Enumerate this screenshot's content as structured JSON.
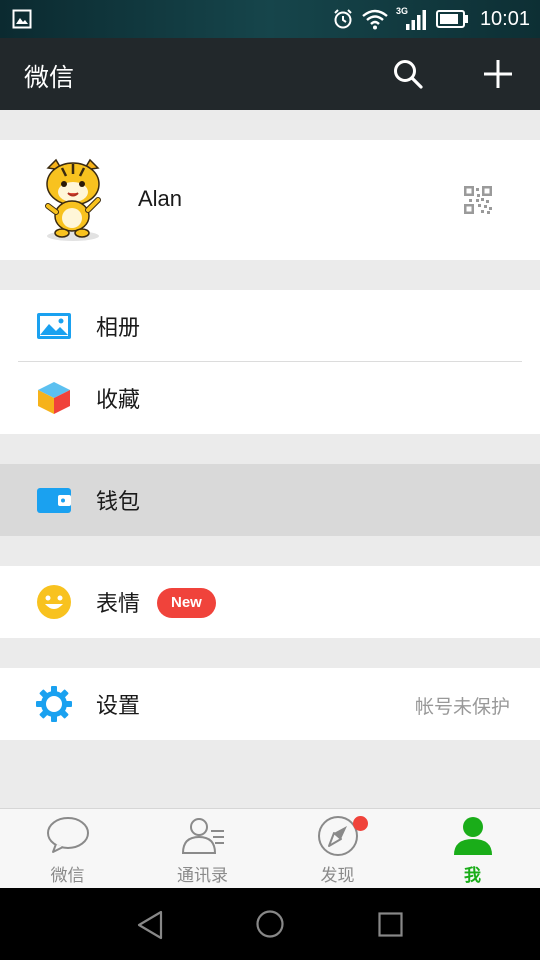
{
  "status_bar": {
    "time": "10:01",
    "network": "3G",
    "icons": [
      "image-notification-icon",
      "alarm-icon",
      "wifi-icon",
      "signal-icon",
      "battery-icon"
    ]
  },
  "header": {
    "title": "微信",
    "icons": [
      "search-icon",
      "add-icon"
    ]
  },
  "profile": {
    "name": "Alan",
    "icons": [
      "avatar",
      "qr-code-icon"
    ]
  },
  "menu": {
    "album": {
      "label": "相册",
      "icon": "album-icon"
    },
    "favorites": {
      "label": "收藏",
      "icon": "favorites-icon"
    },
    "wallet": {
      "label": "钱包",
      "icon": "wallet-icon"
    },
    "stickers": {
      "label": "表情",
      "badge": "New",
      "icon": "sticker-smile-icon"
    },
    "settings": {
      "label": "设置",
      "hint": "帐号未保护",
      "icon": "settings-gear-icon"
    }
  },
  "tabs": [
    {
      "label": "微信",
      "icon": "chat-bubble-icon",
      "active": false
    },
    {
      "label": "通讯录",
      "icon": "contacts-icon",
      "active": false
    },
    {
      "label": "发现",
      "icon": "discover-compass-icon",
      "active": false,
      "has_dot": true
    },
    {
      "label": "我",
      "icon": "me-person-icon",
      "active": true
    }
  ],
  "nav_bar": {
    "icons": [
      "back-icon",
      "home-icon",
      "recent-apps-icon"
    ]
  },
  "colors": {
    "accent_green": "#1aad19",
    "header_bg": "#22282b",
    "badge_red": "#f0433b",
    "icon_blue": "#1aa1f0"
  }
}
